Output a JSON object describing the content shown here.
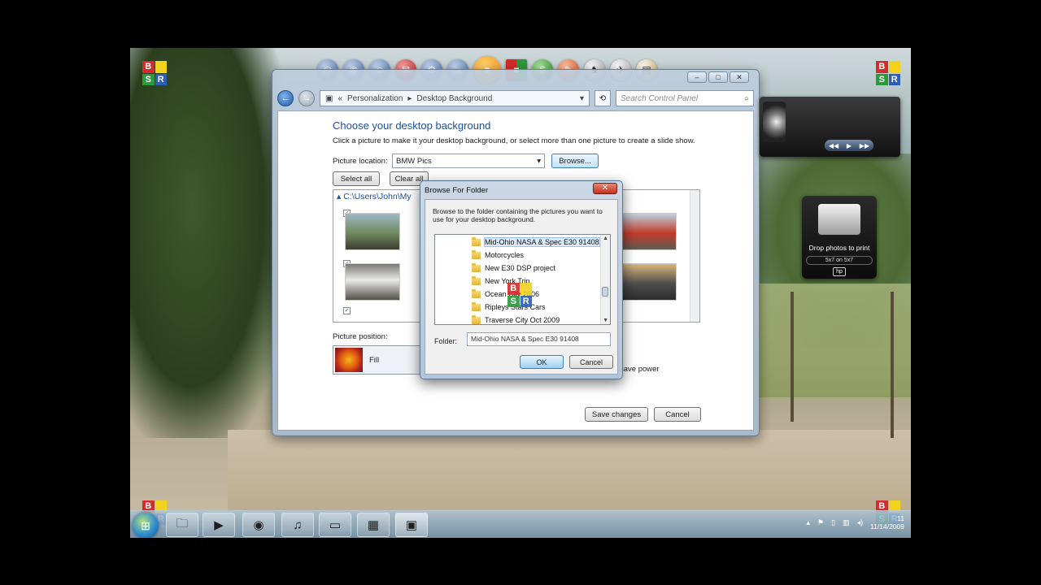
{
  "colors": {
    "accent": "#1e4e9c",
    "logo_b": "#d42b2b",
    "logo_y": "#f2d21b",
    "logo_s": "#2b9a3b",
    "logo_r": "#2a5fb8"
  },
  "logo": {
    "b": "B",
    "s": "S",
    "r": "R"
  },
  "dock_icons": [
    "globe-icon",
    "camera-icon",
    "user-icon",
    "mail-icon",
    "gear-icon",
    "weather-icon",
    "smiley-icon",
    "logo-icon",
    "money-icon",
    "paint-icon",
    "cow-icon",
    "plane-icon",
    "folder-icon"
  ],
  "window": {
    "breadcrumb": [
      "Personalization",
      "Desktop Background"
    ],
    "search_placeholder": "Search Control Panel",
    "heading": "Choose your desktop background",
    "instruction": "Click a picture to make it your desktop background, or select more than one picture to create a slide show.",
    "picture_location_label": "Picture location:",
    "picture_location_value": "BMW Pics",
    "browse_label": "Browse...",
    "select_all_label": "Select all",
    "clear_all_label": "Clear all",
    "folder_header": "C:\\Users\\John\\My",
    "picture_position_label": "Picture position:",
    "picture_position_value": "Fill",
    "power_text": "save power",
    "save_label": "Save changes",
    "cancel_label": "Cancel"
  },
  "dialog": {
    "title": "Browse For Folder",
    "description": "Browse to the folder containing the pictures you want to use for your desktop background.",
    "tree_items": [
      "Mid-Ohio NASA & Spec E30 91408",
      "Motorcycles",
      "New E30 DSP project",
      "New York Trip",
      "Ocean City 2006",
      "Ripleys Stars Cars",
      "Traverse City Oct 2009"
    ],
    "folder_label": "Folder:",
    "folder_value": "Mid-Ohio NASA & Spec E30 91408",
    "ok_label": "OK",
    "cancel_label": "Cancel"
  },
  "print_gadget": {
    "text": "Drop photos to print",
    "size": "5x7 on 5x7",
    "brand": "hp"
  },
  "taskbar": {
    "apps": [
      "explorer-icon",
      "media-player-icon",
      "firefox-icon",
      "itunes-icon",
      "folder-icon",
      "logo-icon",
      "control-panel-icon"
    ],
    "clock_time": "11",
    "clock_date": "11/14/2009"
  }
}
